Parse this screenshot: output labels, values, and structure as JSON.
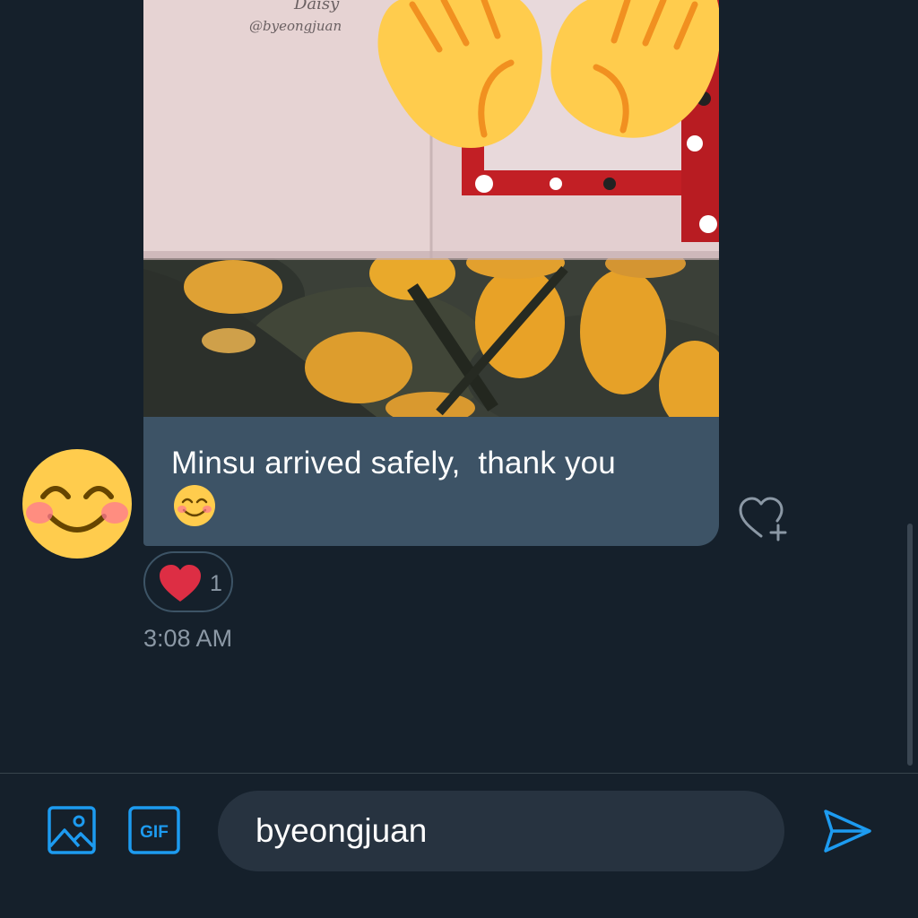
{
  "photo": {
    "card_text_line1": "Daisy",
    "card_text_line2": "@byeongjuan"
  },
  "message": {
    "text": "Minsu arrived safely,  thank you",
    "emoji": "smiling-face-with-smiling-eyes"
  },
  "avatar": {
    "emoji": "smiling-face-with-smiling-eyes"
  },
  "reaction": {
    "emoji": "red-heart",
    "count": "1"
  },
  "timestamp": "3:08 AM",
  "composer": {
    "input_value": "byeongjuan",
    "gif_label": "GIF"
  },
  "colors": {
    "background": "#15202b",
    "bubble": "#3d5366",
    "accent": "#1d9bf0",
    "muted": "#8b98a5",
    "heart": "#dd2e44"
  }
}
